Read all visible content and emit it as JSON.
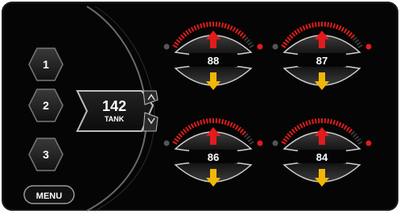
{
  "colors": {
    "background": "#050505",
    "frame": "#1a1a1a",
    "accent_red": "#e21b1b",
    "accent_yellow": "#f2b705",
    "arc_inactive": "#3a3a3a",
    "text": "#ffffff"
  },
  "presets": [
    {
      "label": "1"
    },
    {
      "label": "2"
    },
    {
      "label": "3"
    }
  ],
  "menu_label": "MENU",
  "tank": {
    "value": "142",
    "label": "TANK",
    "icons": [
      "chevron-up-icon",
      "chevron-down-icon"
    ]
  },
  "gauges": [
    {
      "value": "88",
      "level": 0.88
    },
    {
      "value": "87",
      "level": 0.87
    },
    {
      "value": "86",
      "level": 0.86
    },
    {
      "value": "84",
      "level": 0.84
    }
  ]
}
